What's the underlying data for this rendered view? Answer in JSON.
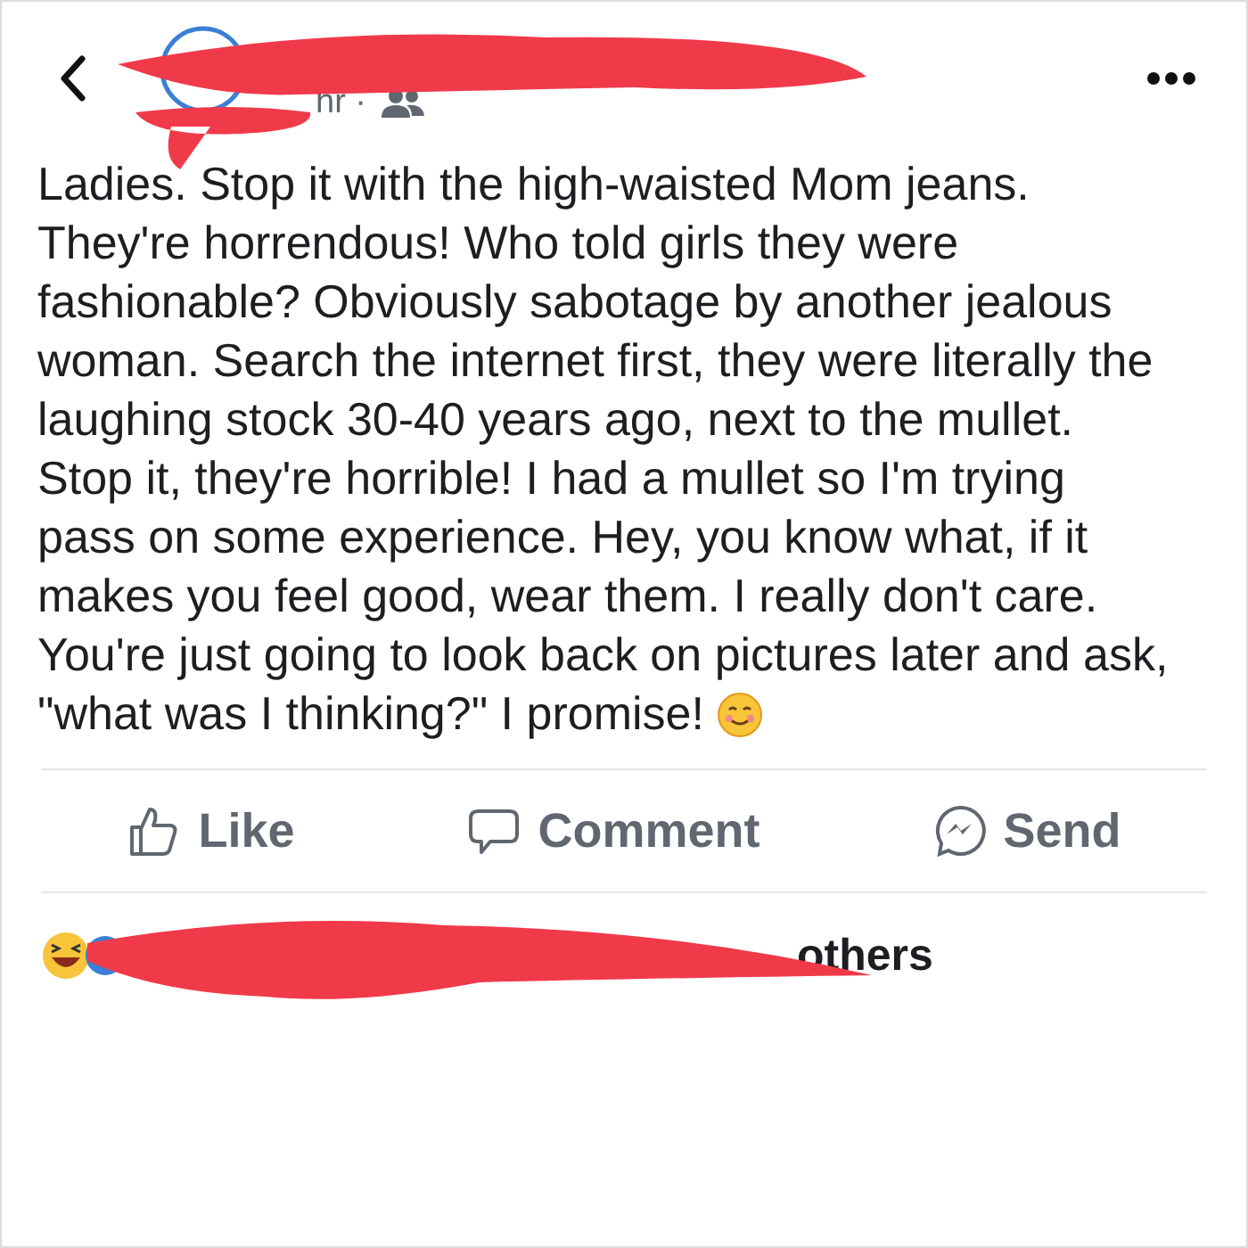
{
  "header": {
    "time": "hr ·"
  },
  "post": {
    "text": "Ladies. Stop it with the high-waisted Mom jeans. They're horrendous! Who told girls they were fashionable? Obviously sabotage by another jealous woman. Search the internet first, they were literally the laughing stock 30-40  years ago, next to the mullet. Stop it, they're horrible! I had a mullet so I'm trying pass on some experience. Hey, you know what, if it makes you feel good, wear them. I really don't care. You're just going to look back on pictures later and ask, \"what was I thinking?\" I promise!"
  },
  "actions": [
    {
      "kind": "like",
      "label": "Like"
    },
    {
      "kind": "comment",
      "label": "Comment"
    },
    {
      "kind": "send",
      "label": "Send"
    }
  ],
  "reactions": {
    "text": "others"
  }
}
